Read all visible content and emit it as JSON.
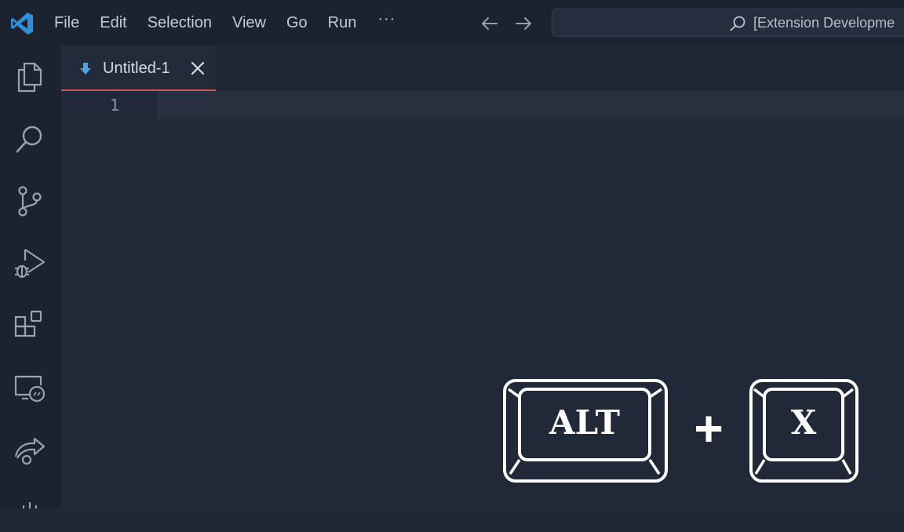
{
  "titlebar": {
    "menu": [
      "File",
      "Edit",
      "Selection",
      "View",
      "Go",
      "Run"
    ],
    "more": "···",
    "search_text": "[Extension Developme"
  },
  "activity_bar": {
    "icons": [
      "explorer-icon",
      "search-icon",
      "source-control-icon",
      "run-debug-icon",
      "extensions-icon",
      "remote-explorer-icon",
      "live-share-icon"
    ]
  },
  "tab": {
    "label": "Untitled-1"
  },
  "editor": {
    "line_numbers": [
      "1"
    ]
  },
  "shortcut": {
    "key1": "ALT",
    "plus": "+",
    "key2": "X"
  },
  "colors": {
    "background": "#202837",
    "titlebar": "#1b2230",
    "tab_active_border": "#c75a5a",
    "logo_blue": "#2f8fd8"
  }
}
